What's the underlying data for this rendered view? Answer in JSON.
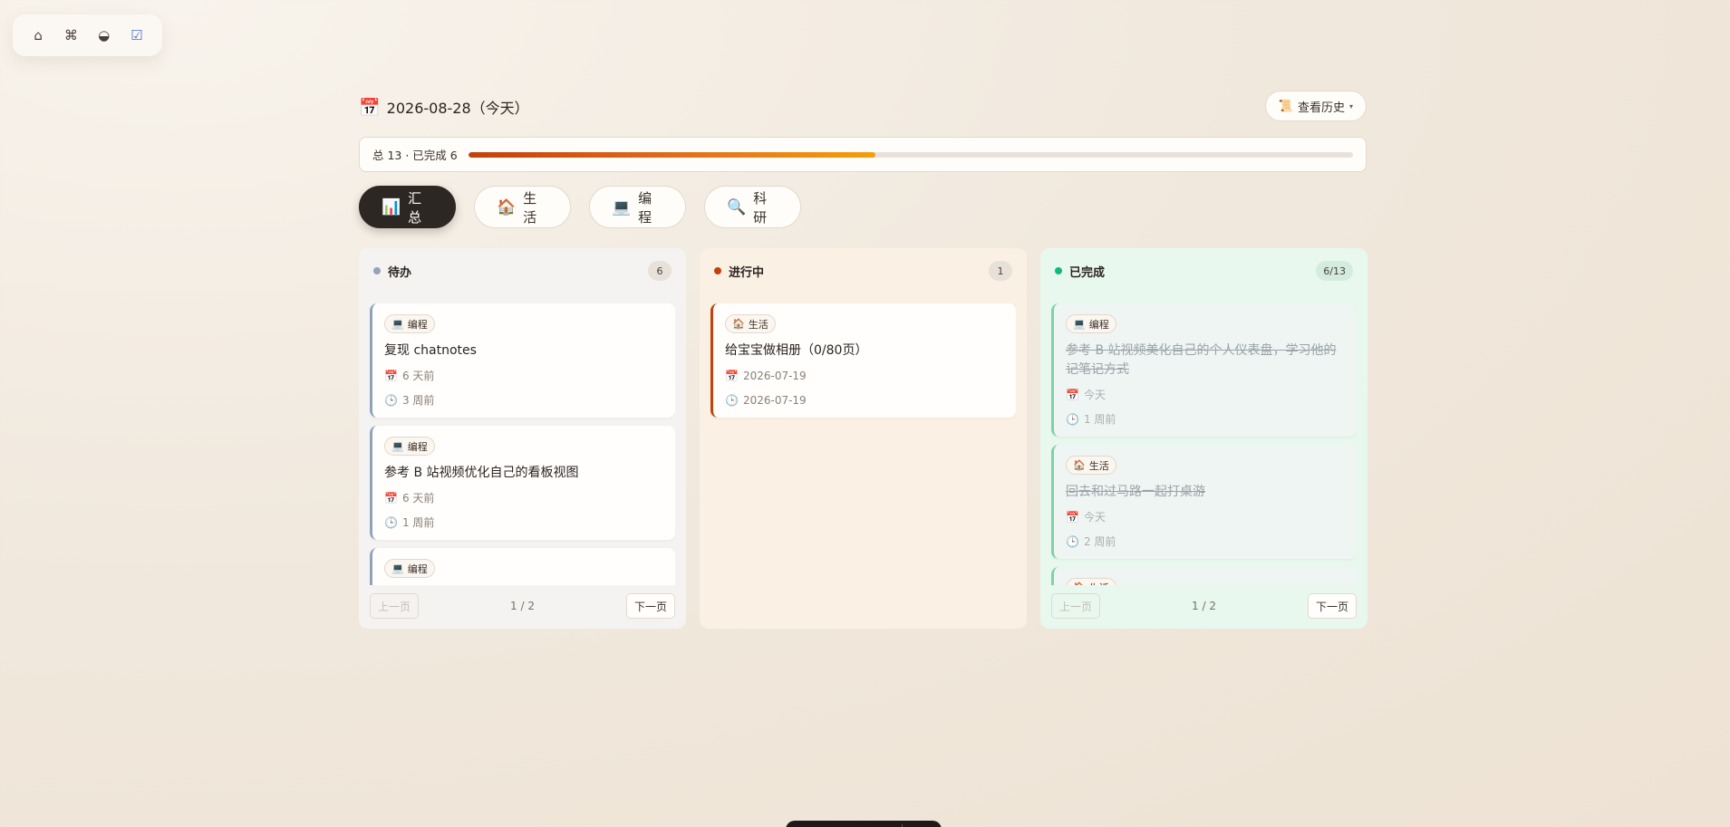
{
  "nav": {
    "items": [
      {
        "icon": "⌂",
        "name": "home-icon"
      },
      {
        "icon": "⌘",
        "name": "command-icon"
      },
      {
        "icon": "◒",
        "name": "theme-toggle-icon"
      },
      {
        "icon": "☑",
        "name": "tasks-icon"
      }
    ]
  },
  "header": {
    "date_icon": "📅",
    "date_title": "2026-08-28（今天）",
    "history_icon": "📜",
    "history_label": "查看历史",
    "history_caret": "▾"
  },
  "progress": {
    "text": "总 13 · 已完成 6",
    "total": 13,
    "completed": 6,
    "fraction": 0.46
  },
  "tabs": [
    {
      "icon": "📊",
      "label": "汇总",
      "active": true
    },
    {
      "icon": "🏠",
      "label": "生活",
      "active": false
    },
    {
      "icon": "💻",
      "label": "编程",
      "active": false
    },
    {
      "icon": "🔍",
      "label": "科研",
      "active": false
    }
  ],
  "columns": {
    "todo": {
      "title": "待办",
      "count": "6",
      "dot_color": "#94a3b8",
      "cards": [
        {
          "tag_icon": "💻",
          "tag": "编程",
          "title": "复现 chatnotes",
          "date_icon": "📅",
          "date": "6 天前",
          "time_icon": "🕒",
          "time": "3 周前"
        },
        {
          "tag_icon": "💻",
          "tag": "编程",
          "title": "参考 B 站视频优化自己的看板视图",
          "date_icon": "📅",
          "date": "6 天前",
          "time_icon": "🕒",
          "time": "1 周前"
        },
        {
          "tag_icon": "💻",
          "tag": "编程",
          "title": "",
          "date_icon": "",
          "date": "",
          "time_icon": "",
          "time": ""
        }
      ],
      "pager": {
        "prev": "上一页",
        "info": "1 / 2",
        "next": "下一页"
      }
    },
    "doing": {
      "title": "进行中",
      "count": "1",
      "dot_color": "#c2410c",
      "cards": [
        {
          "tag_icon": "🏠",
          "tag": "生活",
          "title": "给宝宝做相册（0/80页）",
          "date_icon": "📅",
          "date": "2026-07-19",
          "time_icon": "🕒",
          "time": "2026-07-19"
        }
      ]
    },
    "done": {
      "title": "已完成",
      "count": "6/13",
      "dot_color": "#10b981",
      "cards": [
        {
          "tag_icon": "💻",
          "tag": "编程",
          "title": "参考 B 站视频美化自己的个人仪表盘，学习他的记笔记方式",
          "date_icon": "📅",
          "date": "今天",
          "time_icon": "🕒",
          "time": "1 周前"
        },
        {
          "tag_icon": "🏠",
          "tag": "生活",
          "title": "回去和过马路一起打桌游",
          "date_icon": "📅",
          "date": "今天",
          "time_icon": "🕒",
          "time": "2 周前"
        },
        {
          "tag_icon": "🏠",
          "tag": "生活",
          "title": "",
          "date_icon": "",
          "date": "",
          "time_icon": "",
          "time": ""
        }
      ],
      "pager": {
        "prev": "上一页",
        "info": "1 / 2",
        "next": "下一页"
      }
    }
  }
}
